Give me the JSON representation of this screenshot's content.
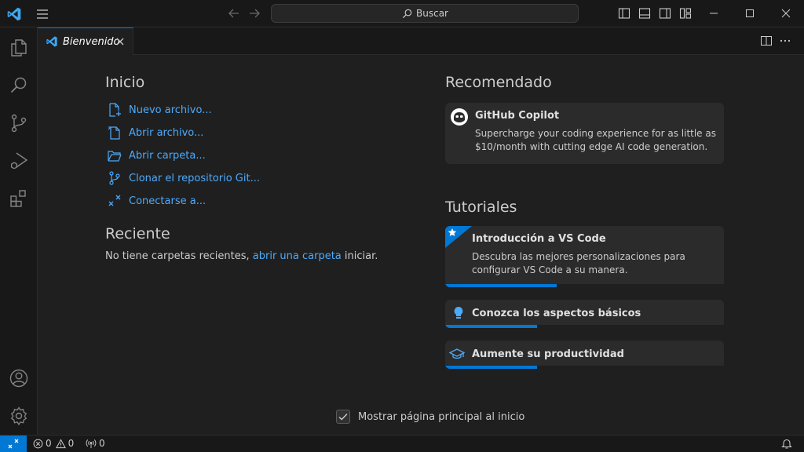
{
  "titlebar": {
    "search_placeholder": "Buscar"
  },
  "tab": {
    "label": "Bienvenido"
  },
  "start": {
    "title": "Inicio",
    "items": [
      {
        "label": "Nuevo archivo...",
        "icon": "new-file-icon"
      },
      {
        "label": "Abrir archivo...",
        "icon": "open-file-icon"
      },
      {
        "label": "Abrir carpeta...",
        "icon": "open-folder-icon"
      },
      {
        "label": "Clonar el repositorio Git...",
        "icon": "git-clone-icon"
      },
      {
        "label": "Conectarse a...",
        "icon": "remote-connect-icon"
      }
    ]
  },
  "recent": {
    "title": "Reciente",
    "text_before": "No tiene carpetas recientes, ",
    "link": "abrir una carpeta",
    "text_after": " iniciar."
  },
  "recommended": {
    "title": "Recomendado",
    "card": {
      "title": "GitHub Copilot",
      "description_line1": "Supercharge your coding experience for as little as",
      "description_line2": "$10/month with cutting edge AI code generation."
    }
  },
  "tutorials": {
    "title": "Tutoriales",
    "items": [
      {
        "title": "Introducción a VS Code",
        "description_line1": "Descubra las mejores personalizaciones para",
        "description_line2": "configurar VS Code a su manera.",
        "progress": 0.4
      },
      {
        "title": "Conozca los aspectos básicos",
        "progress": 0.33
      },
      {
        "title": "Aumente su productividad",
        "progress": 0.33
      }
    ]
  },
  "footer": {
    "checkbox_label": "Mostrar página principal al inicio",
    "checked": true
  },
  "statusbar": {
    "errors": "0",
    "warnings": "0",
    "ports": "0"
  },
  "colors": {
    "accent": "#0078d4",
    "link": "#4daafc"
  }
}
